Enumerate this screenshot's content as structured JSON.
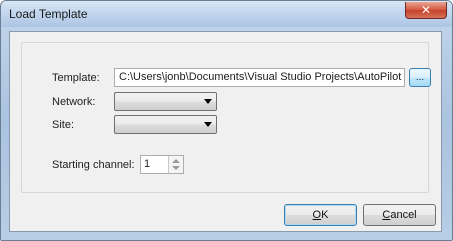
{
  "window": {
    "title": "Load Template",
    "close_glyph": "✕"
  },
  "form": {
    "template_label": "Template:",
    "template_path": "C:\\Users\\jonb\\Documents\\Visual Studio Projects\\AutoPilot",
    "browse_label": "...",
    "network_label": "Network:",
    "network_value": "",
    "site_label": "Site:",
    "site_value": "",
    "starting_channel_label": "Starting channel:",
    "starting_channel_value": "1"
  },
  "buttons": {
    "ok_mnemonic": "O",
    "ok_rest": "K",
    "cancel_mnemonic": "C",
    "cancel_rest": "ancel"
  }
}
